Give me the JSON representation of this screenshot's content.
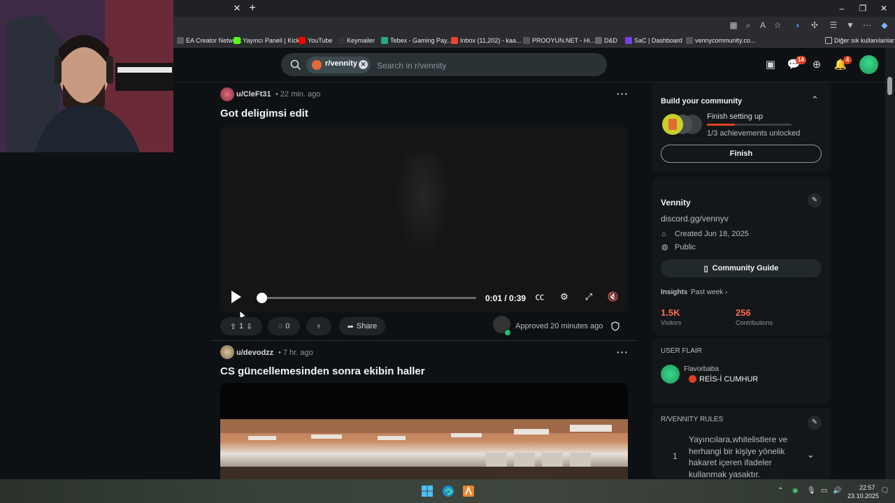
{
  "browser": {
    "bookmarks": [
      {
        "label": "EA Creator Network",
        "color": "#5a5a5a"
      },
      {
        "label": "Yayıncı Paneli | Kick",
        "color": "#53fc18"
      },
      {
        "label": "YouTube",
        "color": "#ff0000"
      },
      {
        "label": "Keymailer",
        "color": "#333"
      },
      {
        "label": "Tebex - Gaming Pay...",
        "color": "#2aa889"
      },
      {
        "label": "Inbox (11,202) - kaa...",
        "color": "#ea4335"
      },
      {
        "label": "PROOYUN.NET - Hi...",
        "color": "#555"
      },
      {
        "label": "D&D",
        "color": "#666"
      },
      {
        "label": "SaC | Dashboard",
        "color": "#7b3fe4"
      },
      {
        "label": "vennycommunity.co...",
        "color": "#555"
      }
    ],
    "other_bookmarks": "Diğer sık kullanılanlar",
    "tab_close": "✕",
    "new_tab": "+"
  },
  "header": {
    "subreddit_chip": "r/vennity",
    "search_placeholder": "Search in r/vennity",
    "chat_badge": "14",
    "notif_badge": "4"
  },
  "posts": [
    {
      "user": "u/CleFt31",
      "time": "• 22 min. ago",
      "title": "Got deligimsi edit",
      "video_time": "0:01 / 0:39",
      "progress": 0.02,
      "votes": "1",
      "comments": "0",
      "share": "Share",
      "approved": "Approved 20 minutes ago"
    },
    {
      "user": "u/devodzz",
      "time": "• 7 hr. ago",
      "title": "CS güncellemesinden sonra ekibin haller"
    }
  ],
  "sidebar": {
    "build": {
      "title": "Build your community",
      "subtitle": "Finish setting up",
      "achievements": "1/3 achievements unlocked",
      "progress": 0.33,
      "button": "Finish"
    },
    "about": {
      "name": "Vennity",
      "link": "discord.gg/vennyv",
      "created": "Created Jun 18, 2025",
      "visibility": "Public",
      "guide_button": "Community Guide",
      "insights_label": "Insights",
      "insights_range": "Past week ›",
      "visitors_value": "1.5K",
      "visitors_label": "Visitors",
      "contrib_value": "256",
      "contrib_label": "Contributions",
      "flair_heading": "USER FLAIR",
      "flair_user": "Flavorbaba",
      "flair_text": "REİS-İ CUMHUR"
    },
    "rules": {
      "heading": "R/VENNITY RULES",
      "items": [
        {
          "num": "1",
          "text": "Yayıncılara,whitelistlere ve herhangi bir kişiye yönelik hakaret içeren ifadeler kullanmak yasaktır."
        }
      ]
    }
  },
  "taskbar": {
    "time": "22:57",
    "date": "23.10.2025"
  }
}
